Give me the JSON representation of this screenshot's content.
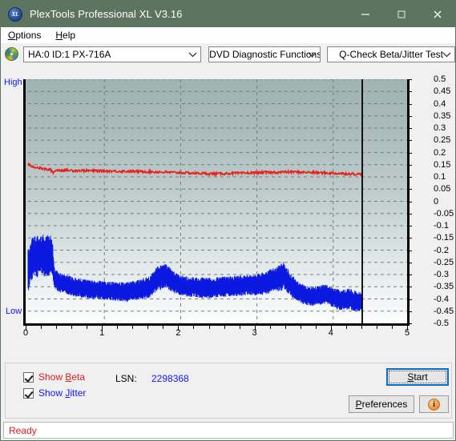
{
  "window": {
    "title": "PlexTools Professional XL V3.16",
    "icon": "xl-logo-icon",
    "minimize_label": "–",
    "maximize_label": "□",
    "close_label": "✕"
  },
  "menubar": {
    "items": [
      {
        "label": "Options",
        "accel": "O"
      },
      {
        "label": "Help",
        "accel": "H"
      }
    ]
  },
  "toolbar": {
    "drive_icon": "disc-drive-icon",
    "drive_combo": {
      "value": "HA:0 ID:1  PX-716A",
      "options": [
        "HA:0 ID:1  PX-716A"
      ]
    },
    "function_combo": {
      "value": "DVD Diagnostic Functions",
      "options": [
        "DVD Diagnostic Functions"
      ]
    },
    "test_combo": {
      "value": "Q-Check Beta/Jitter Test",
      "options": [
        "Q-Check Beta/Jitter Test"
      ]
    }
  },
  "graph": {
    "axis_high_label": "High",
    "axis_low_label": "Low"
  },
  "controls": {
    "show_beta": {
      "label_pre": "Show ",
      "accel": "B",
      "label_post": "eta",
      "checked": true
    },
    "show_jitter": {
      "label_pre": "Show ",
      "accel": "J",
      "label_post": "itter",
      "checked": true
    },
    "lsn_label": "LSN:",
    "lsn_value": "2298368",
    "start_button": {
      "pre": "",
      "accel": "S",
      "post": "tart"
    },
    "preferences_button": {
      "pre": "",
      "accel": "P",
      "post": "references"
    },
    "info_button": "i"
  },
  "statusbar": {
    "text": "Ready"
  },
  "colors": {
    "titlebar": "#5d7460",
    "beta": "#ee1b1b",
    "jitter": "#0b19e0",
    "accent_blue": "#1414ff",
    "status": "#e01b1b"
  },
  "chart_data": {
    "type": "line",
    "title": "Q-Check Beta/Jitter Test",
    "xlabel": "",
    "ylabel": "",
    "xlim": [
      0,
      5
    ],
    "ylim": [
      -0.5,
      0.5
    ],
    "grid": true,
    "legend_position": "below-left",
    "xticks": [
      "0",
      "1",
      "2",
      "3",
      "4",
      "5"
    ],
    "yticks": [
      "0.5",
      "0.45",
      "0.4",
      "0.35",
      "0.3",
      "0.25",
      "0.2",
      "0.15",
      "0.1",
      "0.05",
      "0",
      "-0.05",
      "-0.1",
      "-0.15",
      "-0.2",
      "-0.25",
      "-0.3",
      "-0.35",
      "-0.4",
      "-0.45",
      "-0.5"
    ],
    "data_end_marker_x": 4.38,
    "series": [
      {
        "name": "Beta",
        "color": "#ee1b1b",
        "x": [
          0.0,
          0.06,
          0.12,
          0.18,
          0.24,
          0.3,
          0.33,
          0.36,
          0.42,
          0.5,
          0.6,
          0.7,
          0.8,
          0.9,
          1.0,
          1.1,
          1.2,
          1.3,
          1.4,
          1.5,
          1.6,
          1.7,
          1.8,
          1.9,
          2.0,
          2.1,
          2.2,
          2.3,
          2.4,
          2.5,
          2.6,
          2.7,
          2.8,
          2.9,
          3.0,
          3.1,
          3.2,
          3.3,
          3.4,
          3.5,
          3.6,
          3.7,
          3.8,
          3.9,
          4.0,
          4.1,
          4.2,
          4.3,
          4.38
        ],
        "y": [
          0.15,
          0.143,
          0.138,
          0.134,
          0.131,
          0.129,
          0.116,
          0.128,
          0.127,
          0.127,
          0.126,
          0.126,
          0.125,
          0.125,
          0.124,
          0.124,
          0.123,
          0.123,
          0.122,
          0.122,
          0.121,
          0.12,
          0.119,
          0.118,
          0.117,
          0.116,
          0.115,
          0.114,
          0.113,
          0.113,
          0.114,
          0.115,
          0.115,
          0.116,
          0.117,
          0.118,
          0.118,
          0.119,
          0.12,
          0.12,
          0.119,
          0.118,
          0.117,
          0.116,
          0.115,
          0.114,
          0.113,
          0.112,
          0.11
        ]
      },
      {
        "name": "Jitter",
        "color": "#0b19e0",
        "x": [
          0.0,
          0.03,
          0.06,
          0.09,
          0.12,
          0.15,
          0.18,
          0.21,
          0.24,
          0.27,
          0.3,
          0.32,
          0.34,
          0.36,
          0.4,
          0.45,
          0.5,
          0.55,
          0.6,
          0.65,
          0.7,
          0.8,
          0.9,
          1.0,
          1.1,
          1.2,
          1.3,
          1.4,
          1.5,
          1.6,
          1.65,
          1.7,
          1.75,
          1.8,
          1.85,
          1.9,
          2.0,
          2.1,
          2.2,
          2.3,
          2.4,
          2.5,
          2.6,
          2.7,
          2.8,
          2.9,
          3.0,
          3.1,
          3.2,
          3.3,
          3.35,
          3.4,
          3.45,
          3.5,
          3.6,
          3.7,
          3.8,
          3.9,
          4.0,
          4.1,
          4.2,
          4.3,
          4.38
        ],
        "y_center": [
          -0.285,
          -0.255,
          -0.225,
          -0.22,
          -0.23,
          -0.225,
          -0.215,
          -0.225,
          -0.22,
          -0.225,
          -0.225,
          -0.23,
          -0.31,
          -0.32,
          -0.33,
          -0.335,
          -0.34,
          -0.345,
          -0.35,
          -0.352,
          -0.355,
          -0.36,
          -0.362,
          -0.365,
          -0.368,
          -0.37,
          -0.37,
          -0.365,
          -0.36,
          -0.35,
          -0.33,
          -0.315,
          -0.31,
          -0.305,
          -0.315,
          -0.33,
          -0.345,
          -0.35,
          -0.352,
          -0.355,
          -0.355,
          -0.352,
          -0.35,
          -0.348,
          -0.345,
          -0.342,
          -0.34,
          -0.335,
          -0.325,
          -0.315,
          -0.305,
          -0.325,
          -0.345,
          -0.36,
          -0.38,
          -0.39,
          -0.385,
          -0.38,
          -0.395,
          -0.405,
          -0.4,
          -0.41,
          -0.415
        ],
        "band": [
          0.06,
          0.055,
          0.06,
          0.058,
          0.06,
          0.058,
          0.055,
          0.058,
          0.057,
          0.058,
          0.057,
          0.055,
          0.03,
          0.028,
          0.027,
          0.026,
          0.026,
          0.026,
          0.026,
          0.026,
          0.026,
          0.025,
          0.025,
          0.026,
          0.026,
          0.026,
          0.027,
          0.027,
          0.028,
          0.03,
          0.032,
          0.034,
          0.034,
          0.033,
          0.032,
          0.03,
          0.028,
          0.028,
          0.028,
          0.028,
          0.028,
          0.028,
          0.028,
          0.028,
          0.028,
          0.028,
          0.03,
          0.032,
          0.034,
          0.036,
          0.038,
          0.034,
          0.03,
          0.028,
          0.027,
          0.026,
          0.026,
          0.026,
          0.027,
          0.028,
          0.028,
          0.028,
          0.026
        ]
      }
    ]
  }
}
